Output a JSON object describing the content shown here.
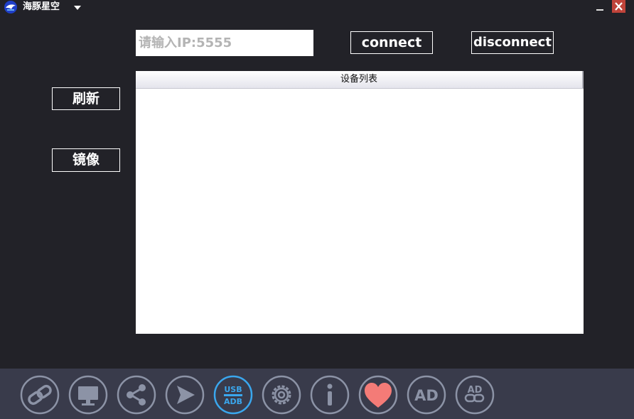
{
  "window": {
    "title": "海豚星空",
    "icons": {
      "logo": "app-logo-icon",
      "dropdown": "caret-down-icon",
      "minimize": "minimize-icon",
      "close": "close-icon"
    },
    "close_color": "#c0433a"
  },
  "connection": {
    "ip_placeholder": "请输入IP:5555",
    "ip_value": "",
    "connect_label": "connect",
    "disconnect_label": "disconnect"
  },
  "actions": {
    "refresh_label": "刷新",
    "mirror_label": "镜像"
  },
  "device_list": {
    "column_header": "设备列表",
    "rows": []
  },
  "toolbar": {
    "items": [
      {
        "icon": "link-icon",
        "active": false
      },
      {
        "icon": "monitor-icon",
        "active": false
      },
      {
        "icon": "share-icon",
        "active": false
      },
      {
        "icon": "send-icon",
        "active": false
      },
      {
        "icon": "usb-adb-icon",
        "active": true,
        "text_top": "USB",
        "text_bottom": "ADB"
      },
      {
        "icon": "gear-icon",
        "active": false
      },
      {
        "icon": "info-icon",
        "active": false
      },
      {
        "icon": "heart-icon",
        "active": false
      },
      {
        "icon": "ad-icon",
        "active": false,
        "text": "AD"
      },
      {
        "icon": "ad-link-icon",
        "active": false,
        "text": "AD"
      }
    ]
  },
  "colors": {
    "background": "#222228",
    "toolbar_bg": "#393b4b",
    "icon_gray": "#8c93a6",
    "icon_active": "#3aa7ee",
    "heart": "#f47b77"
  }
}
